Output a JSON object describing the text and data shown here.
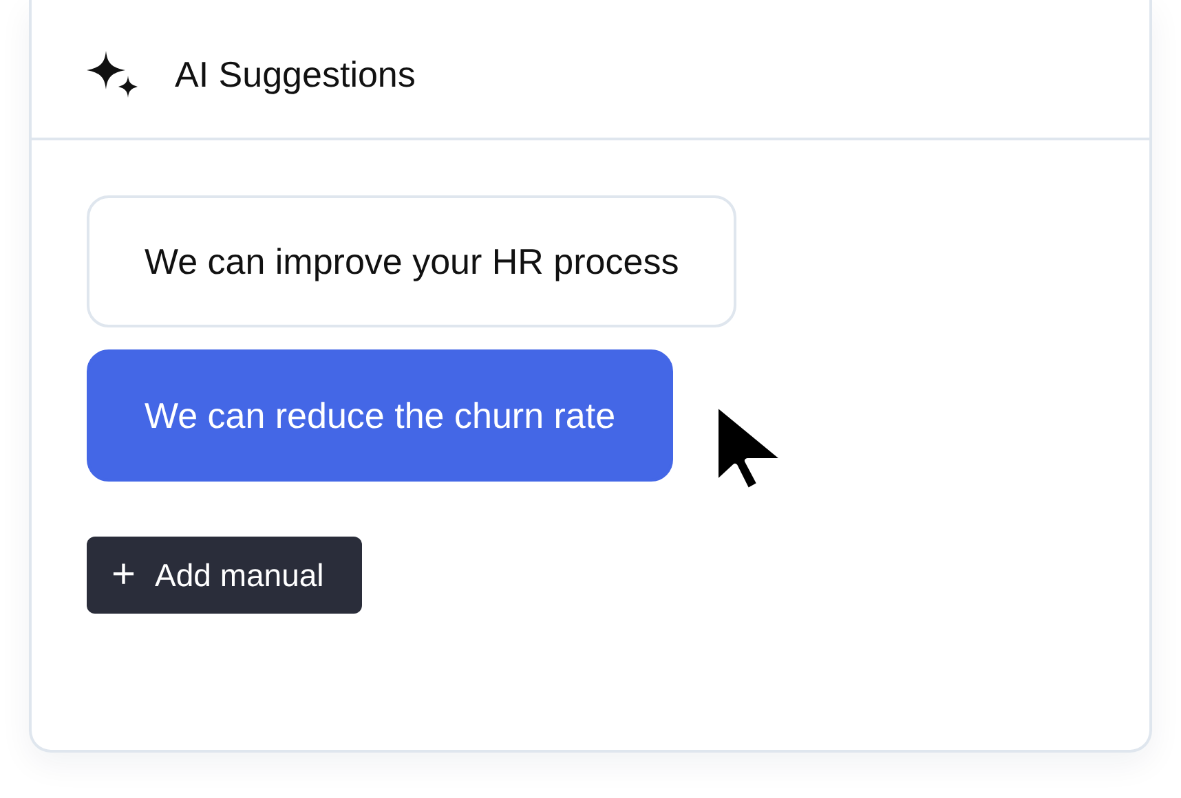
{
  "panel": {
    "title": "AI Suggestions"
  },
  "suggestions": [
    {
      "label": "We can improve your HR process",
      "selected": false
    },
    {
      "label": "We can reduce the churn rate",
      "selected": true
    }
  ],
  "add_button": {
    "icon": "+",
    "label": "Add manual"
  }
}
